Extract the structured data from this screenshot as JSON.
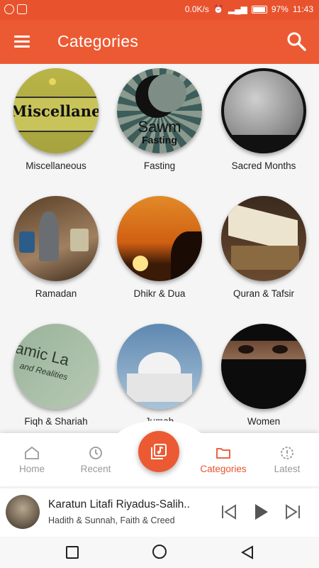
{
  "status_bar": {
    "speed": "0.0K/s",
    "battery": "97%",
    "time": "11:43"
  },
  "app_bar": {
    "title": "Categories"
  },
  "categories": [
    {
      "label": "Miscellaneous",
      "icon": "miscellaneous"
    },
    {
      "label": "Fasting",
      "icon": "fasting",
      "image_text": "Sawm",
      "image_subtext": "Fasting"
    },
    {
      "label": "Sacred Months",
      "icon": "moon"
    },
    {
      "label": "Ramadan",
      "icon": "lantern"
    },
    {
      "label": "Dhikr & Dua",
      "icon": "sunset"
    },
    {
      "label": "Quran & Tafsir",
      "icon": "quran"
    },
    {
      "label": "Fiqh & Shariah",
      "icon": "fiqh"
    },
    {
      "label": "Jumah",
      "icon": "mosque"
    },
    {
      "label": "Women",
      "icon": "niqab"
    }
  ],
  "misc_image_text": "Miscellaneous",
  "fiqh_image_text": "amic La",
  "fiqh_image_subtext": "and Realities",
  "bottom_nav": {
    "home": "Home",
    "recent": "Recent",
    "categories": "Categories",
    "latest": "Latest"
  },
  "player": {
    "track": "Karatun Litafi Riyadus-Salih..",
    "subtitle": "Hadith & Sunnah, Faith & Creed"
  },
  "colors": {
    "primary": "#ec5a33",
    "active": "#e8532e"
  }
}
